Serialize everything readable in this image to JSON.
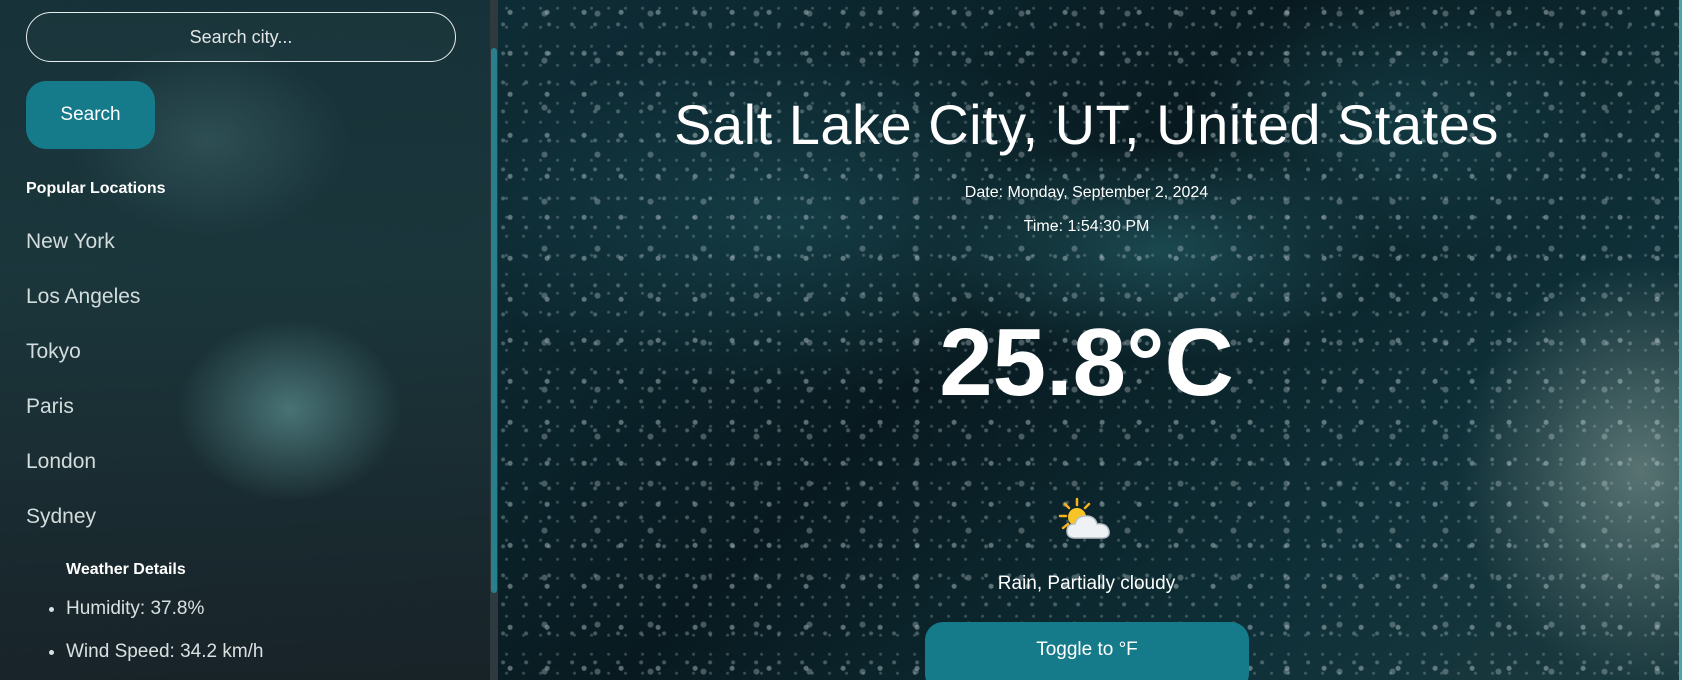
{
  "sidebar": {
    "search_placeholder": "Search city...",
    "search_button": "Search",
    "popular_heading": "Popular Locations",
    "locations": [
      {
        "label": "New York"
      },
      {
        "label": "Los Angeles"
      },
      {
        "label": "Tokyo"
      },
      {
        "label": "Paris"
      },
      {
        "label": "London"
      },
      {
        "label": "Sydney"
      }
    ],
    "details_heading": "Weather Details",
    "details": [
      {
        "text": "Humidity: 37.8%"
      },
      {
        "text": "Wind Speed: 34.2 km/h"
      }
    ]
  },
  "main": {
    "city": "Salt Lake City, UT, United States",
    "date": "Date: Monday, September 2, 2024",
    "time": "Time: 1:54:30 PM",
    "temperature": "25.8°C",
    "icon": "partly-cloudy-icon",
    "condition": "Rain, Partially cloudy",
    "toggle_label": "Toggle to °F"
  },
  "colors": {
    "accent_button": "#157a8a",
    "scrollbar_thumb": "#2a7f8c",
    "text": "#ffffff"
  }
}
